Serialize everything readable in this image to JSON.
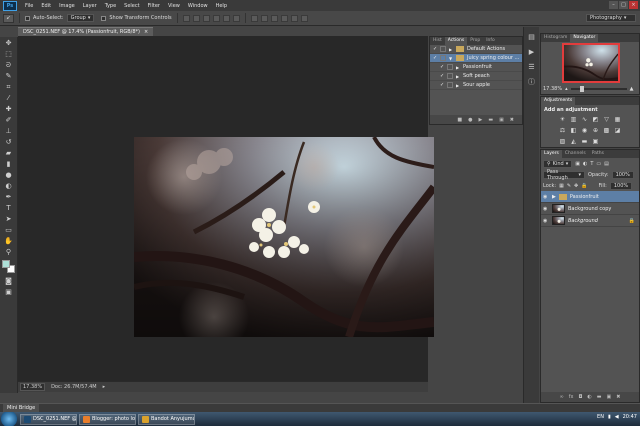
{
  "app": {
    "logo": "Ps"
  },
  "menu": [
    "File",
    "Edit",
    "Image",
    "Layer",
    "Type",
    "Select",
    "Filter",
    "View",
    "Window",
    "Help"
  ],
  "window_controls": {
    "minimize": "–",
    "maximize": "□",
    "close": "×"
  },
  "options": {
    "tool_icon": "move-tool-icon",
    "auto_select_label": "Auto-Select:",
    "auto_select_value": "Group",
    "show_transform_label": "Show Transform Controls",
    "workspace": "Photography"
  },
  "document": {
    "tab_title": "DSC_0251.NEF @ 17.4% (Passionfruit, RGB/8*)",
    "close": "×"
  },
  "statusbar": {
    "zoom": "17.38%",
    "doc_info": "Doc: 26.7M/57.4M"
  },
  "actions_panel": {
    "tabs": [
      "Hist",
      "Actions",
      "Prop",
      "Info"
    ],
    "active_tab": "Actions",
    "rows": [
      {
        "label": "Default Actions",
        "type": "set"
      },
      {
        "label": "Juicy spring colour ...",
        "type": "set",
        "highlighted": true
      },
      {
        "label": "Passionfruit",
        "type": "action"
      },
      {
        "label": "Soft peach",
        "type": "action"
      },
      {
        "label": "Sour apple",
        "type": "action"
      }
    ],
    "footer_icons": [
      "stop-icon",
      "record-icon",
      "play-icon",
      "new-set-icon",
      "new-action-icon",
      "delete-icon"
    ]
  },
  "navigator_panel": {
    "tabs": [
      "Histogram",
      "Navigator"
    ],
    "active_tab": "Navigator",
    "zoom": "17.38%",
    "zoom_level": 0.17
  },
  "adjustments_panel": {
    "tab": "Adjustments",
    "title": "Add an adjustment"
  },
  "layers_panel": {
    "tabs": [
      "Layers",
      "Channels",
      "Paths"
    ],
    "active_tab": "Layers",
    "filter_value": "Kind",
    "blend_mode": "Pass Through",
    "opacity_label": "Opacity:",
    "opacity_value": "100%",
    "lock_label": "Lock:",
    "fill_label": "Fill:",
    "fill_value": "100%",
    "layers": [
      {
        "name": "Passionfruit",
        "kind": "group",
        "highlighted": true
      },
      {
        "name": "Background copy",
        "kind": "pixel"
      },
      {
        "name": "Background",
        "kind": "pixel",
        "locked": true
      }
    ]
  },
  "mini_bridge": {
    "tab": "Mini Bridge"
  },
  "taskbar": {
    "items": [
      {
        "label": "DSC_0251.NEF @ 17....",
        "icon_color": "#1c4a73"
      },
      {
        "label": "Blogger: photo log...",
        "icon_color": "#e87d2b"
      },
      {
        "label": "Bandot Anyujumu (1...",
        "icon_color": "#d9a12c"
      }
    ],
    "lang": "EN",
    "clock": "20:47"
  },
  "colors": {
    "foreground_swatch": "#aee0d8",
    "background_swatch": "#ffffff",
    "highlight": "#5d7fa6"
  }
}
